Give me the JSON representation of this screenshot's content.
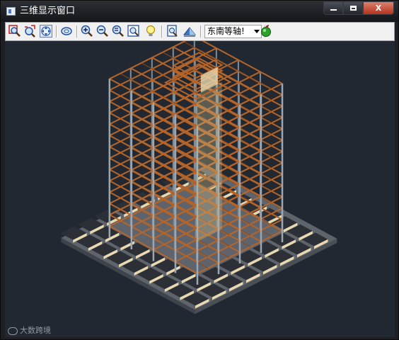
{
  "window": {
    "title": "三维显示窗口",
    "controls": {
      "minimize": "minimize",
      "maximize": "maximize",
      "close": "X"
    }
  },
  "toolbar": {
    "buttons": [
      {
        "icon": "zoom-window-icon"
      },
      {
        "icon": "realtime-zoom-icon"
      },
      {
        "icon": "pan-icon",
        "pressed": true
      },
      {
        "icon": "orbit-icon"
      },
      {
        "icon": "zoom-in-icon"
      },
      {
        "icon": "zoom-out-icon"
      },
      {
        "icon": "zoom-previous-icon"
      },
      {
        "icon": "zoom-extents-icon"
      },
      {
        "icon": "light-bulb-icon"
      },
      {
        "icon": "render-settings-icon"
      },
      {
        "icon": "shade-mode-icon"
      },
      {
        "icon": "apple-color-icon"
      }
    ],
    "view_select": {
      "value": "东南等轴测",
      "shown": "东南等轴!"
    }
  },
  "viewport": {
    "background": "#212831",
    "beam_color": "#b5652a",
    "column_color": "#7f8c98",
    "slab_color": "#e8d9b0",
    "ground_color": "#5f646c"
  },
  "watermark": {
    "text": "大数跨境"
  }
}
